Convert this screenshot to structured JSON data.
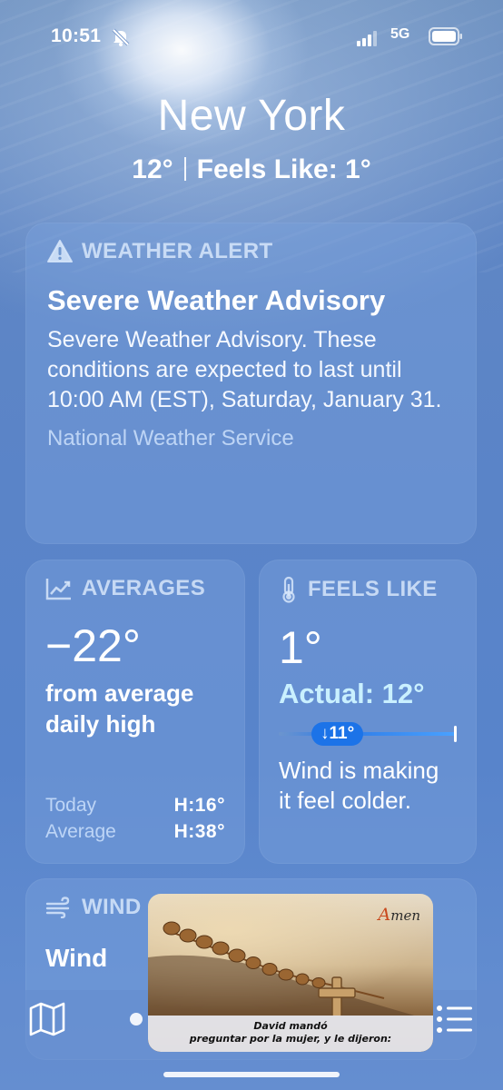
{
  "status_bar": {
    "time": "10:51",
    "network": "5G",
    "icons": [
      "bell-slash-icon",
      "signal-bars-icon",
      "battery-icon"
    ]
  },
  "location": {
    "city": "New York",
    "temperature": "12°",
    "feels_like": "Feels Like: 1°"
  },
  "alert": {
    "header": "WEATHER ALERT",
    "title": "Severe Weather Advisory",
    "body": "Severe Weather Advisory. These conditions are expected to last until 10:00 AM (EST), Saturday, January 31.",
    "source": "National Weather Service"
  },
  "averages": {
    "header": "AVERAGES",
    "value": "−22°",
    "description": "from average daily high",
    "rows": [
      {
        "label": "Today",
        "value": "H:16°"
      },
      {
        "label": "Average",
        "value": "H:38°"
      }
    ]
  },
  "feels_like": {
    "header": "FEELS LIKE",
    "value": "1°",
    "actual": "Actual: 12°",
    "difference": "↓11°",
    "note": "Wind is making it feel colder."
  },
  "wind": {
    "header": "WIND",
    "label": "Wind"
  },
  "video_overlay": {
    "brand": "Amen",
    "caption_line1": "David mandó",
    "caption_line2": "preguntar por la mujer, y le dijeron:"
  },
  "colors": {
    "accent_blue": "#1c73e8",
    "actual_temp": "#c9f0ff"
  }
}
